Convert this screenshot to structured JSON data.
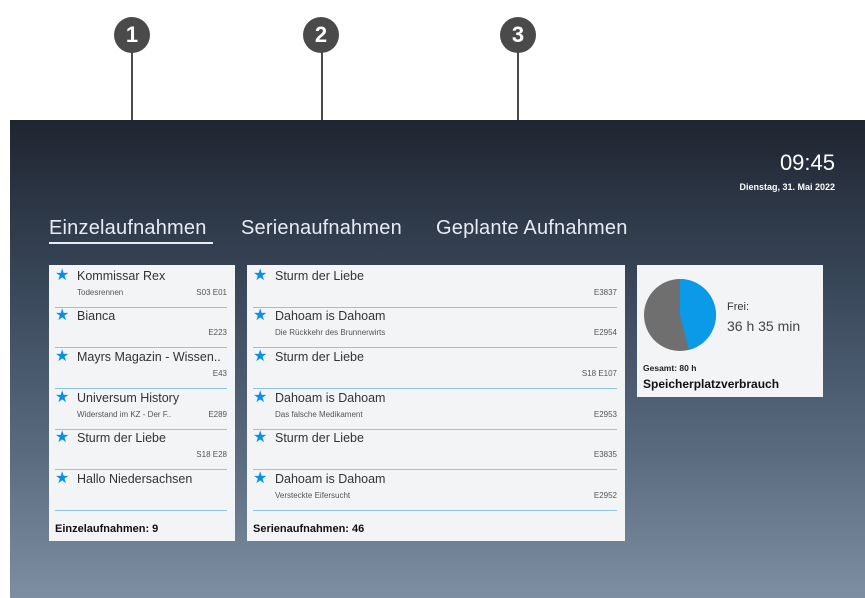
{
  "callouts": [
    "1",
    "2",
    "3"
  ],
  "header": {
    "time": "09:45",
    "date": "Dienstag, 31. Mai 2022"
  },
  "tabs": [
    {
      "label": "Einzelaufnahmen",
      "active": true
    },
    {
      "label": "Serienaufnahmen",
      "active": false
    },
    {
      "label": "Geplante Aufnahmen",
      "active": false
    }
  ],
  "single_recordings": {
    "items": [
      {
        "title": "Kommissar Rex",
        "subtitle": "Todesrennen",
        "episode": "S03 E01"
      },
      {
        "title": "Bianca",
        "subtitle": "",
        "episode": "E223"
      },
      {
        "title": "Mayrs Magazin - Wissen..",
        "subtitle": "",
        "episode": "E43"
      },
      {
        "title": "Universum History",
        "subtitle": "Widerstand im KZ - Der F..",
        "episode": "E289"
      },
      {
        "title": "Sturm der Liebe",
        "subtitle": "",
        "episode": "S18 E28"
      },
      {
        "title": "Hallo Niedersachsen",
        "subtitle": "",
        "episode": ""
      }
    ],
    "footer": "Einzelaufnahmen: 9"
  },
  "series_recordings": {
    "items": [
      {
        "title": "Sturm der Liebe",
        "subtitle": "",
        "episode": "E3837"
      },
      {
        "title": "Dahoam is Dahoam",
        "subtitle": "Die Rückkehr des Brunnerwirts",
        "episode": "E2954"
      },
      {
        "title": "Sturm der Liebe",
        "subtitle": "",
        "episode": "S18 E107"
      },
      {
        "title": "Dahoam is Dahoam",
        "subtitle": "Das falsche Medikament",
        "episode": "E2953"
      },
      {
        "title": "Sturm der Liebe",
        "subtitle": "",
        "episode": "E3835"
      },
      {
        "title": "Dahoam is Dahoam",
        "subtitle": "Versteckte Eifersucht",
        "episode": "E2952"
      }
    ],
    "footer": "Serienaufnahmen: 46"
  },
  "storage": {
    "free_label": "Frei:",
    "free_value": "36 h 35 min",
    "total": "Gesamt: 80 h",
    "title": "Speicherplatzverbrauch",
    "free_fraction": 0.46,
    "used_color": "#6f6f6f",
    "free_color": "#0a9ae8"
  },
  "star_icon": "★"
}
